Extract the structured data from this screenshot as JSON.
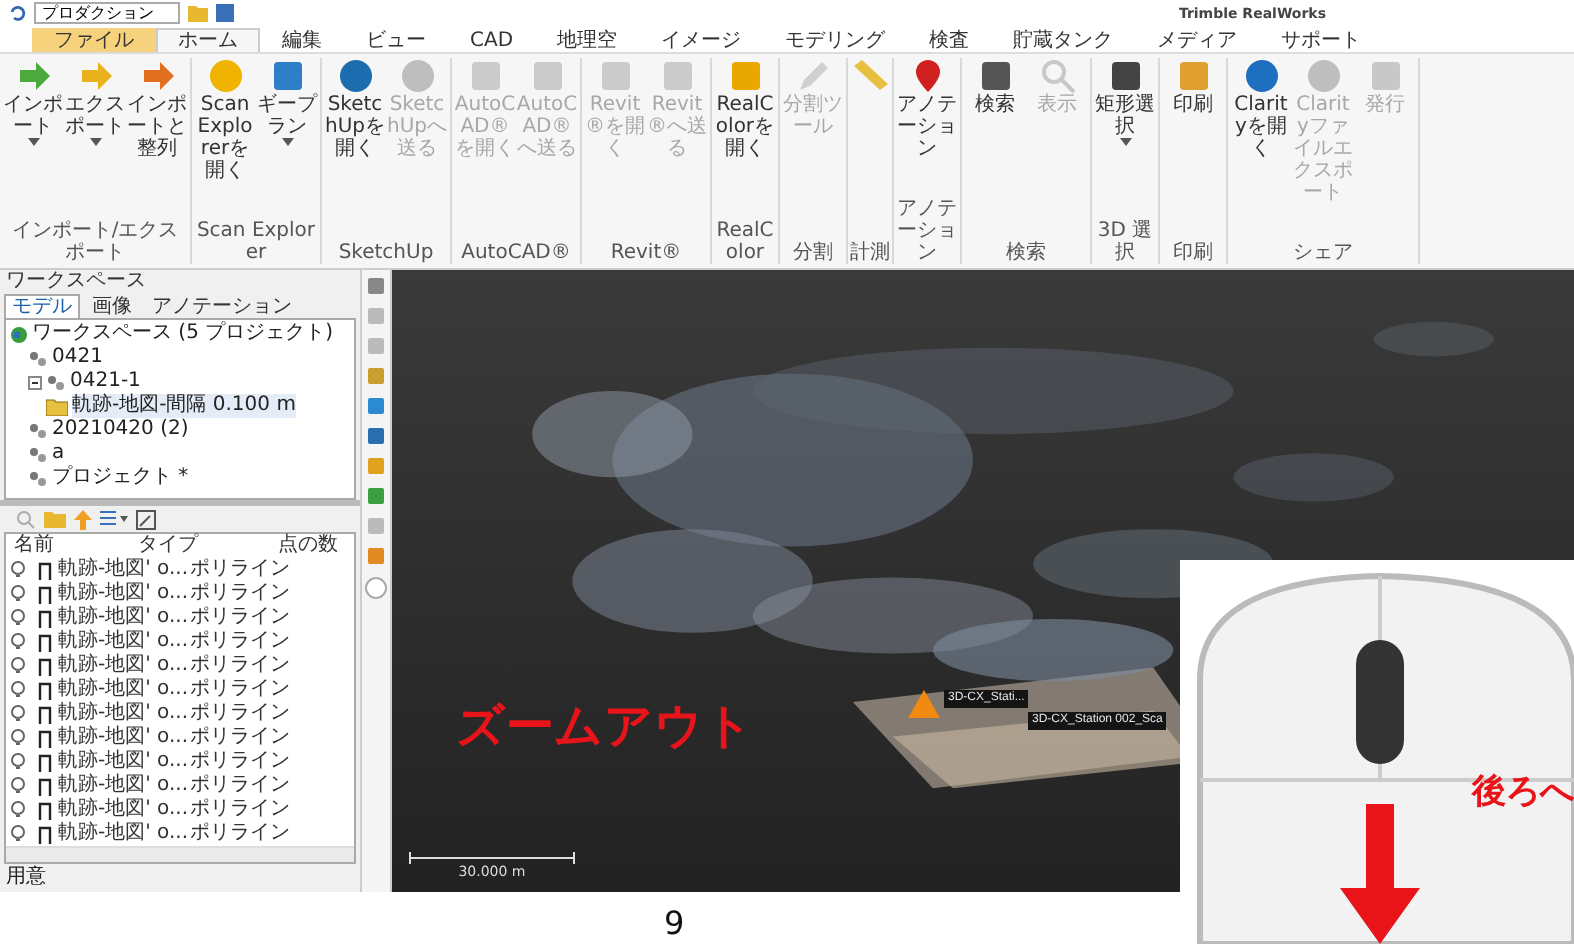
{
  "quick_access": {
    "profile": "プロダクション"
  },
  "window": {
    "title": "Trimble RealWorks"
  },
  "ribbon": {
    "tabs": [
      {
        "label": "ファイル",
        "kind": "file",
        "selected": false
      },
      {
        "label": "ホーム",
        "kind": "tab",
        "selected": true
      },
      {
        "label": "編集",
        "kind": "tab",
        "selected": false
      },
      {
        "label": "ビュー",
        "kind": "tab",
        "selected": false
      },
      {
        "label": "CAD",
        "kind": "tab",
        "selected": false
      },
      {
        "label": "地理空",
        "kind": "tab",
        "selected": false
      },
      {
        "label": "イメージ",
        "kind": "tab",
        "selected": false
      },
      {
        "label": "モデリング",
        "kind": "tab",
        "selected": false
      },
      {
        "label": "検査",
        "kind": "tab",
        "selected": false
      },
      {
        "label": "貯蔵タンク",
        "kind": "tab",
        "selected": false
      },
      {
        "label": "メディア",
        "kind": "tab",
        "selected": false
      },
      {
        "label": "サポート",
        "kind": "tab",
        "selected": false
      }
    ],
    "groups": [
      {
        "label": "インポート/エクスポート",
        "buttons": [
          {
            "label": "インポート",
            "disabled": false,
            "menu": true
          },
          {
            "label": "エクスポート",
            "disabled": false,
            "menu": true
          },
          {
            "label": "インポートと整列",
            "disabled": false,
            "menu": false
          }
        ]
      },
      {
        "label": "Scan Explorer",
        "buttons": [
          {
            "label": "Scan Explorerを開く",
            "disabled": false,
            "menu": false
          },
          {
            "label": "ギープラン",
            "disabled": false,
            "menu": true
          }
        ]
      },
      {
        "label": "SketchUp",
        "buttons": [
          {
            "label": "SketchUpを開く",
            "disabled": false,
            "menu": false
          },
          {
            "label": "SketchUpへ送る",
            "disabled": true,
            "menu": false
          }
        ]
      },
      {
        "label": "AutoCAD®",
        "buttons": [
          {
            "label": "AutoCAD®を開く",
            "disabled": true,
            "menu": false
          },
          {
            "label": "AutoCAD®へ送る",
            "disabled": true,
            "menu": false
          }
        ]
      },
      {
        "label": "Revit®",
        "buttons": [
          {
            "label": "Revit®を開く",
            "disabled": true,
            "menu": false
          },
          {
            "label": "Revit®へ送る",
            "disabled": true,
            "menu": false
          }
        ]
      },
      {
        "label": "RealColor",
        "buttons": [
          {
            "label": "RealColorを開く",
            "disabled": false,
            "menu": false
          }
        ]
      },
      {
        "label": "分割",
        "buttons": [
          {
            "label": "分割ツール",
            "disabled": true,
            "menu": false
          }
        ]
      },
      {
        "label": "計測"
      },
      {
        "label": "アノテーション",
        "buttons": [
          {
            "label": "アノテーション",
            "disabled": false,
            "menu": false
          }
        ]
      },
      {
        "label": "検索",
        "buttons": [
          {
            "label": "検索",
            "disabled": false,
            "menu": false
          },
          {
            "label": "表示",
            "disabled": true,
            "menu": false
          }
        ]
      },
      {
        "label": "3D 選択",
        "buttons": [
          {
            "label": "矩形選択",
            "disabled": false,
            "menu": true
          }
        ]
      },
      {
        "label": "印刷",
        "buttons": [
          {
            "label": "印刷",
            "disabled": false,
            "menu": false
          }
        ]
      },
      {
        "label": "シェア",
        "buttons": [
          {
            "label": "Clarityを開く",
            "disabled": false,
            "menu": false
          },
          {
            "label": "Clarityファイルエクスポート",
            "disabled": true,
            "menu": false
          },
          {
            "label": "発行",
            "disabled": true,
            "menu": false
          }
        ]
      }
    ]
  },
  "workspace": {
    "title": "ワークスペース",
    "tabs": [
      {
        "label": "モデル",
        "selected": true
      },
      {
        "label": "画像",
        "selected": false
      },
      {
        "label": "アノテーション",
        "selected": false
      }
    ],
    "tree": [
      {
        "label": "ワークスペース (5 プロジェクト)",
        "kind": "root",
        "selected": false,
        "children": [
          {
            "label": "0421",
            "kind": "project",
            "selected": false
          },
          {
            "label": "0421-1",
            "kind": "project",
            "selected": false,
            "expanded": true,
            "children": [
              {
                "label": "軌跡-地図-間隔 0.100 m",
                "kind": "folder",
                "selected": true
              }
            ]
          },
          {
            "label": "20210420 (2)",
            "kind": "project",
            "selected": false
          },
          {
            "label": "a",
            "kind": "project",
            "selected": false
          },
          {
            "label": "プロジェクト *",
            "kind": "project",
            "selected": false
          }
        ]
      }
    ]
  },
  "properties": {
    "columns": [
      "名前",
      "タイプ",
      "点の数"
    ],
    "rows": [
      {
        "name": "軌跡-地図' o...",
        "type": "ポリライン"
      },
      {
        "name": "軌跡-地図' o...",
        "type": "ポリライン"
      },
      {
        "name": "軌跡-地図' o...",
        "type": "ポリライン"
      },
      {
        "name": "軌跡-地図' o...",
        "type": "ポリライン"
      },
      {
        "name": "軌跡-地図' o...",
        "type": "ポリライン"
      },
      {
        "name": "軌跡-地図' o...",
        "type": "ポリライン"
      },
      {
        "name": "軌跡-地図' o...",
        "type": "ポリライン"
      },
      {
        "name": "軌跡-地図' o...",
        "type": "ポリライン"
      },
      {
        "name": "軌跡-地図' o...",
        "type": "ポリライン"
      },
      {
        "name": "軌跡-地図' o...",
        "type": "ポリライン"
      },
      {
        "name": "軌跡-地図' o...",
        "type": "ポリライン"
      },
      {
        "name": "軌跡-地図' o...",
        "type": "ポリライン"
      }
    ]
  },
  "status_bar": {
    "text": "用意"
  },
  "viewport": {
    "stations": [
      "3D-CX_Stati...",
      "3D-CX_Station 002_Sca"
    ],
    "scale": "30.000 m",
    "caption": "ズームアウト"
  },
  "mouse_hint": {
    "text": "後ろへ"
  },
  "page_number": "9"
}
